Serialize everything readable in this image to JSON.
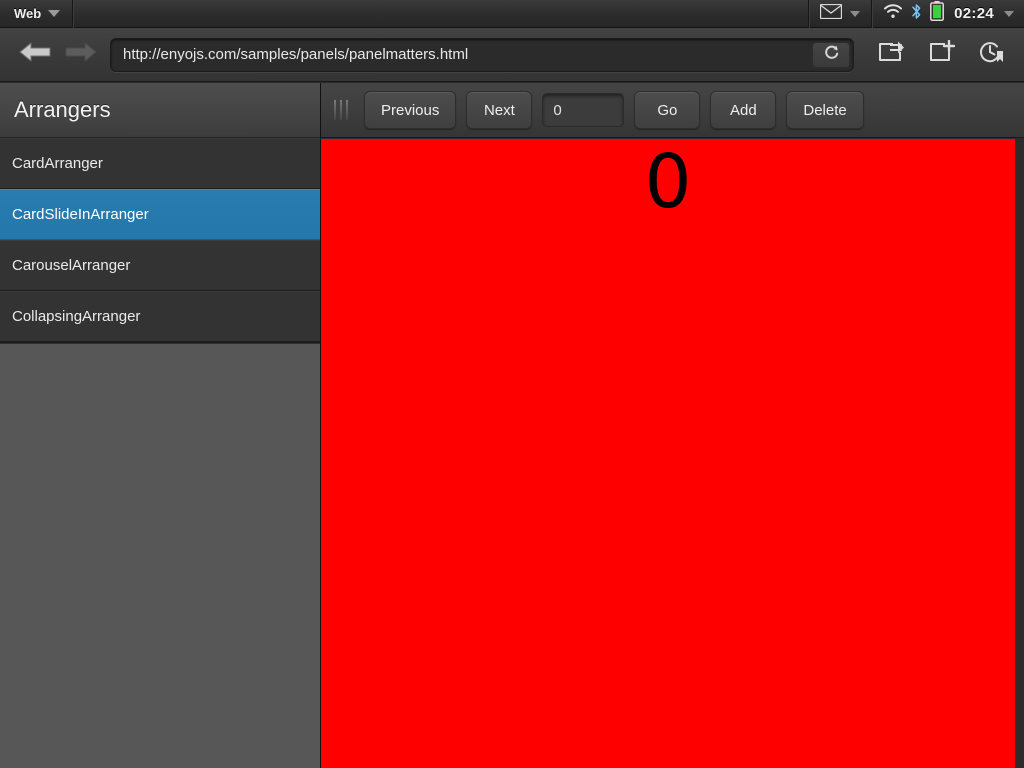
{
  "statusbar": {
    "app_label": "Web",
    "app_menu_icon": "chevron-down-icon",
    "mail_icon": "envelope-icon",
    "mail_menu_icon": "chevron-down-icon",
    "wifi_icon": "wifi-icon",
    "bluetooth_icon": "bluetooth-icon",
    "battery_icon": "battery-full-icon",
    "battery_color": "#3ad13a",
    "clock": "02:24",
    "system_menu_icon": "chevron-down-icon"
  },
  "browser": {
    "back_icon": "arrow-left-icon",
    "forward_icon": "arrow-right-icon",
    "url": "http://enyojs.com/samples/panels/panelmatters.html",
    "url_placeholder": "Enter URL",
    "reload_icon": "reload-icon",
    "share_icon": "share-icon",
    "new_tab_icon": "new-tab-icon",
    "history_icon": "history-bookmark-icon"
  },
  "sidebar": {
    "title": "Arrangers",
    "selected_color": "#2277ab",
    "items": [
      {
        "label": "CardArranger",
        "selected": false
      },
      {
        "label": "CardSlideInArranger",
        "selected": true
      },
      {
        "label": "CarouselArranger",
        "selected": false
      },
      {
        "label": "CollapsingArranger",
        "selected": false
      }
    ]
  },
  "toolbar": {
    "grip_icon": "drag-handle-icon",
    "previous_label": "Previous",
    "next_label": "Next",
    "index_value": "0",
    "index_placeholder": "",
    "go_label": "Go",
    "add_label": "Add",
    "delete_label": "Delete"
  },
  "panel": {
    "number": "0",
    "background_color": "#ff0000",
    "text_color": "#000000"
  }
}
